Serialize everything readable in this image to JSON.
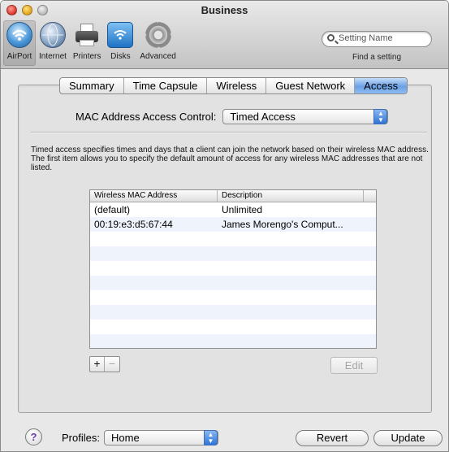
{
  "window": {
    "title": "Business"
  },
  "toolbar": {
    "items": [
      {
        "label": "AirPort",
        "icon": "airport-icon",
        "selected": true
      },
      {
        "label": "Internet",
        "icon": "internet-icon",
        "selected": false
      },
      {
        "label": "Printers",
        "icon": "printer-icon",
        "selected": false
      },
      {
        "label": "Disks",
        "icon": "disk-icon",
        "selected": false
      },
      {
        "label": "Advanced",
        "icon": "gear-icon",
        "selected": false
      }
    ],
    "search": {
      "placeholder": "Setting Name",
      "caption": "Find a setting"
    }
  },
  "tabs": [
    {
      "label": "Summary",
      "active": false
    },
    {
      "label": "Time Capsule",
      "active": false
    },
    {
      "label": "Wireless",
      "active": false
    },
    {
      "label": "Guest Network",
      "active": false
    },
    {
      "label": "Access",
      "active": true
    }
  ],
  "access": {
    "mac_control_label": "MAC Address Access Control:",
    "mac_control_value": "Timed Access",
    "description": "Timed access specifies times and days that a client can join the network based on their wireless MAC address. The first item allows you to specify the default amount of access for any wireless MAC addresses that are not listed.",
    "table": {
      "columns": [
        "Wireless MAC Address",
        "Description"
      ],
      "rows": [
        {
          "mac": "(default)",
          "description": "Unlimited"
        },
        {
          "mac": "00:19:e3:d5:67:44",
          "description": "James Morengo's Comput..."
        }
      ]
    },
    "add_label": "+",
    "remove_label": "−",
    "edit_label": "Edit"
  },
  "footer": {
    "help_label": "?",
    "profiles_label": "Profiles:",
    "profiles_value": "Home",
    "revert_label": "Revert",
    "update_label": "Update"
  },
  "colors": {
    "accent": "#3a7bd5",
    "tab_active": "#6aa0e6"
  }
}
